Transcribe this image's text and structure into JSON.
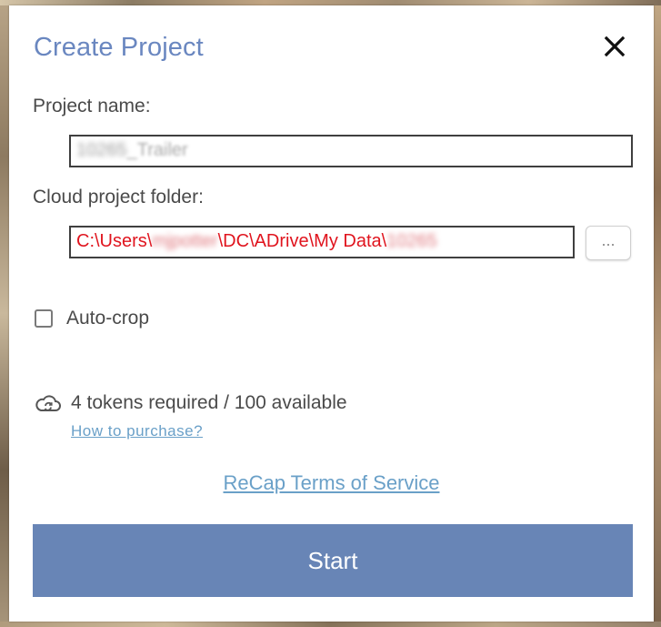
{
  "dialog": {
    "title": "Create Project",
    "close_icon": "close-icon"
  },
  "project_name": {
    "label": "Project name:",
    "value_visible": "_Trailer",
    "value_redacted": "10265"
  },
  "cloud_folder": {
    "label": "Cloud project folder:",
    "value_prefix": "C:\\Users\\",
    "value_redacted_user": "mjpotter",
    "value_middle": "\\DC\\ADrive\\My Data\\",
    "value_redacted_tail": "10265",
    "browse_label": "..."
  },
  "auto_crop": {
    "label": "Auto-crop",
    "checked": false
  },
  "tokens": {
    "icon": "cloud-sync-icon",
    "text": "4 tokens required / 100 available",
    "purchase_link": "How to purchase?"
  },
  "terms_link": "ReCap Terms of Service",
  "start_button": "Start",
  "colors": {
    "title": "#6a87c0",
    "start_bg": "#6885b6",
    "link": "#6aa0c8",
    "folder_text": "#e0141e"
  }
}
